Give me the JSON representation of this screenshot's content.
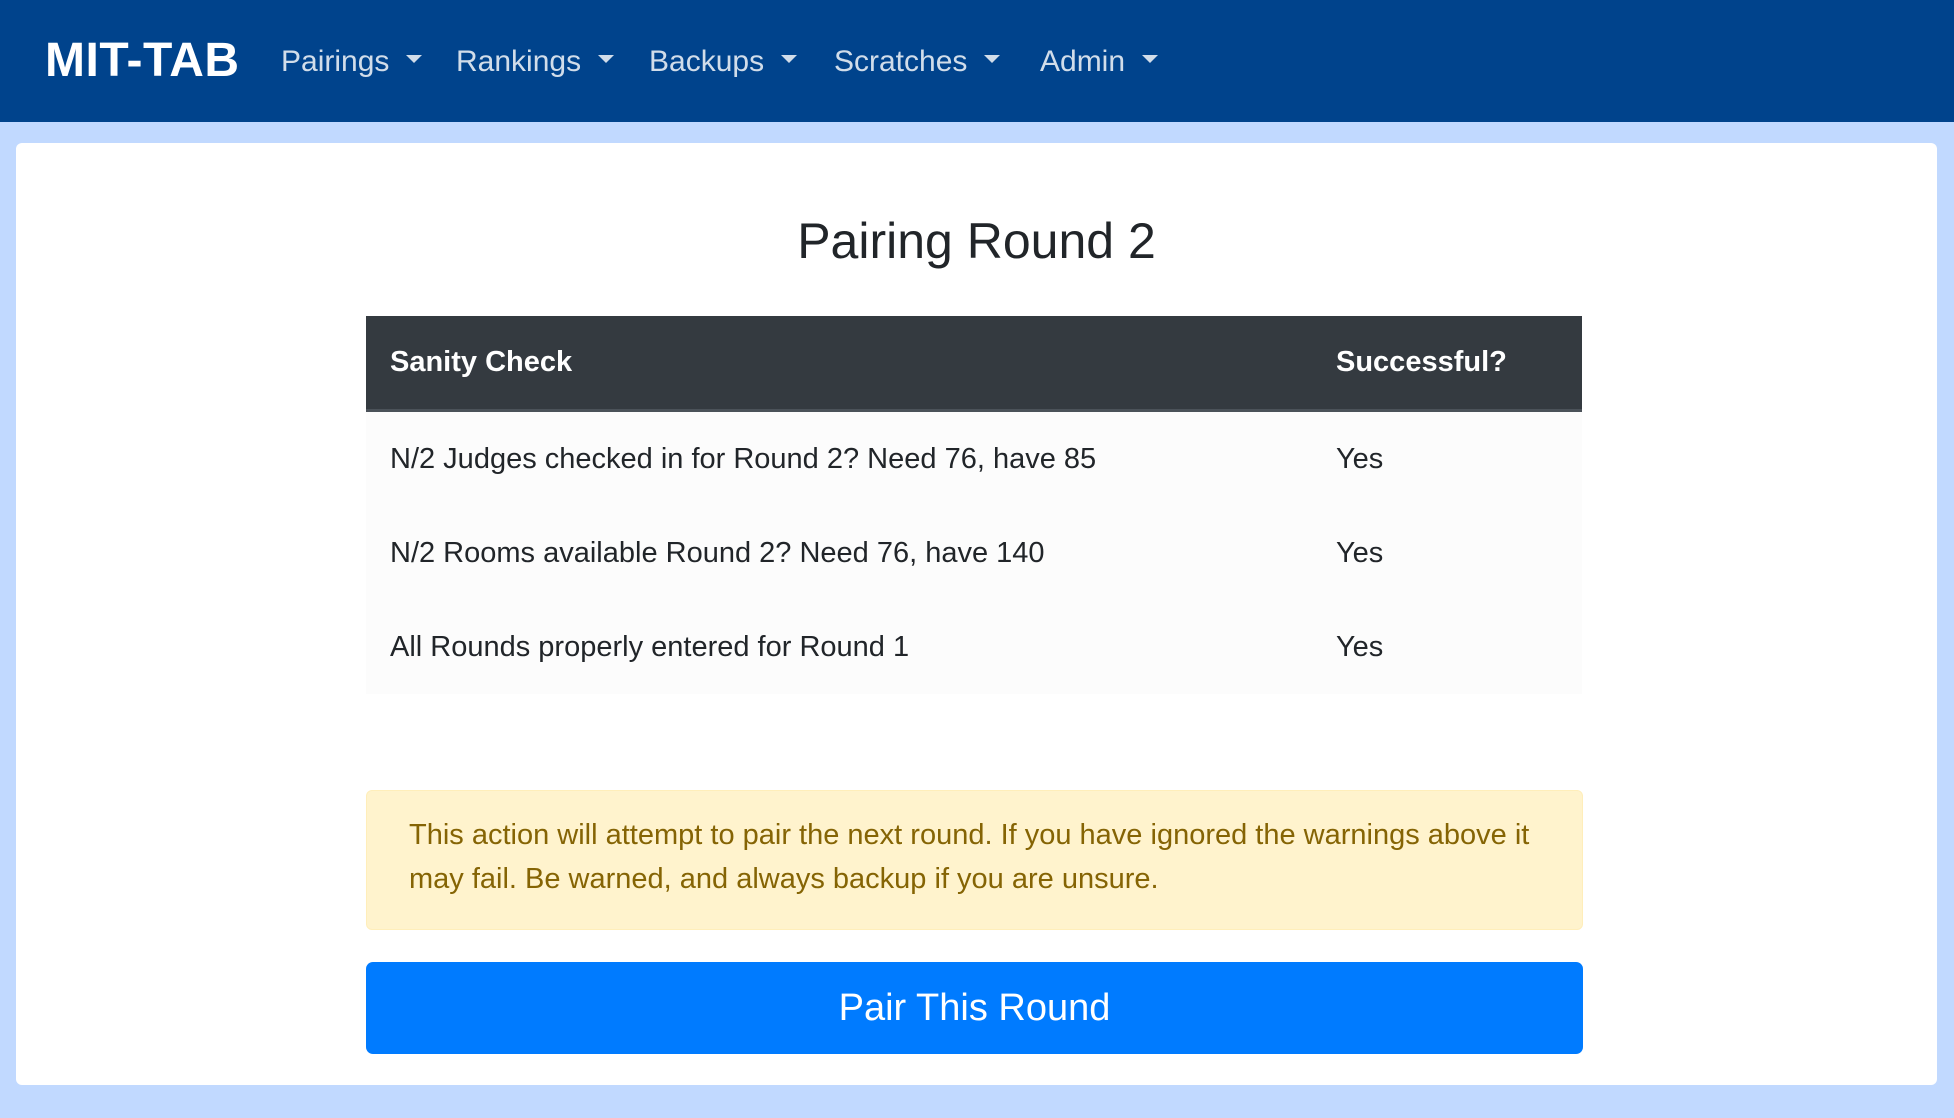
{
  "navbar": {
    "brand": "MIT-TAB",
    "items": [
      {
        "label": "Pairings"
      },
      {
        "label": "Rankings"
      },
      {
        "label": "Backups"
      },
      {
        "label": "Scratches"
      },
      {
        "label": "Admin"
      }
    ]
  },
  "page": {
    "title": "Pairing Round 2"
  },
  "table": {
    "headers": [
      "Sanity Check",
      "Successful?"
    ],
    "rows": [
      {
        "check": "N/2 Judges checked in for Round 2? Need 76, have 85",
        "result": "Yes"
      },
      {
        "check": "N/2 Rooms available Round 2? Need 76, have 140",
        "result": "Yes"
      },
      {
        "check": "All Rounds properly entered for Round 1",
        "result": "Yes"
      }
    ]
  },
  "alert": {
    "text": "This action will attempt to pair the next round. If you have ignored the warnings above it may fail. Be warned, and always backup if you are unsure."
  },
  "actions": {
    "pair_button": "Pair This Round"
  },
  "colors": {
    "navbar": "#00438c",
    "page_background": "#c1d9ff",
    "table_header": "#343a40",
    "alert_background": "#fff3cd",
    "alert_text": "#856404",
    "primary_button": "#007bff"
  }
}
